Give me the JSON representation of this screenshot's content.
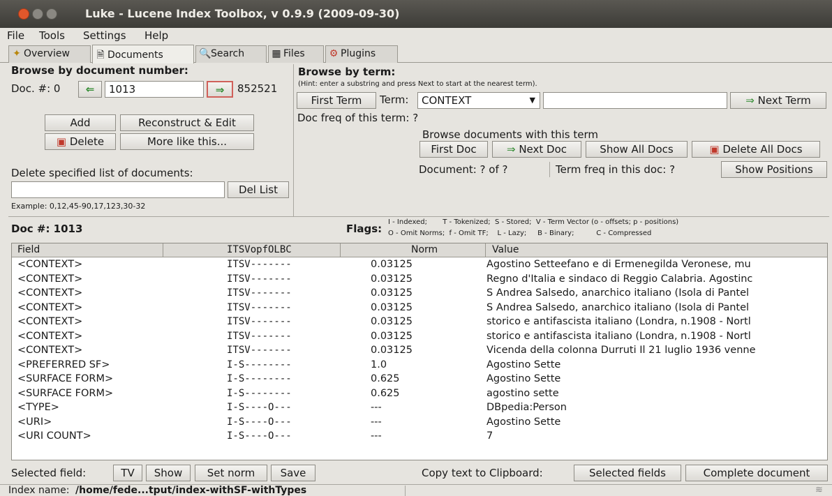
{
  "window": {
    "title": "Luke - Lucene Index Toolbox, v 0.9.9 (2009-09-30)"
  },
  "menu": [
    "File",
    "Tools",
    "Settings",
    "Help"
  ],
  "tabs": [
    {
      "label": "Overview",
      "icon": "wand-icon"
    },
    {
      "label": "Documents",
      "icon": "documents-icon",
      "active": true
    },
    {
      "label": "Search",
      "icon": "search-icon"
    },
    {
      "label": "Files",
      "icon": "files-icon"
    },
    {
      "label": "Plugins",
      "icon": "plugins-icon"
    }
  ],
  "browse_doc": {
    "heading": "Browse by document number:",
    "doc_label": "Doc. #: 0",
    "doc_value": "1013",
    "max_doc": "852521",
    "add": "Add",
    "reconstruct": "Reconstruct & Edit",
    "delete": "Delete",
    "more_like": "More like this...",
    "delete_list_label": "Delete specified list of documents:",
    "delete_list_value": "",
    "del_list": "Del List",
    "example": "Example: 0,12,45-90,17,123,30-32"
  },
  "browse_term": {
    "heading": "Browse by term:",
    "hint": "(Hint: enter a substring and press Next to start at the nearest term).",
    "first_term": "First Term",
    "term_label": "Term:",
    "term_field": "CONTEXT",
    "term_value": "",
    "next_term": "Next Term",
    "doc_freq": "Doc freq of this term: ?",
    "browse_docs_label": "Browse documents with this term",
    "first_doc": "First Doc",
    "next_doc": "Next Doc",
    "show_all": "Show All Docs",
    "delete_all": "Delete All Docs",
    "document_of": "Document: ?  of  ?",
    "term_freq": "Term freq in this doc: ?",
    "show_positions": "Show Positions"
  },
  "doc_header": {
    "doc_num": "Doc #: 1013",
    "flags_label": "Flags:",
    "flags_line1": "I - Indexed;       T - Tokenized;  S - Stored;  V - Term Vector (o - offsets; p - positions)",
    "flags_line2": "O - Omit Norms;  f - Omit TF;    L - Lazy;     B - Binary;          C - Compressed"
  },
  "table": {
    "columns": [
      "Field",
      "ITSVopfOLBC",
      "Norm",
      "Value"
    ],
    "rows": [
      [
        "<CONTEXT>",
        "ITSV-------",
        "0.03125",
        "Agostino Setteefano e di Ermenegilda Veronese, mu"
      ],
      [
        "<CONTEXT>",
        "ITSV-------",
        "0.03125",
        "Regno d'Italia e sindaco di Reggio Calabria. Agostinc"
      ],
      [
        "<CONTEXT>",
        "ITSV-------",
        "0.03125",
        "S Andrea Salsedo, anarchico italiano (Isola di Pantel"
      ],
      [
        "<CONTEXT>",
        "ITSV-------",
        "0.03125",
        "S Andrea Salsedo, anarchico italiano (Isola di Pantel"
      ],
      [
        "<CONTEXT>",
        "ITSV-------",
        "0.03125",
        "storico e antifascista italiano (Londra, n.1908 - Nortl"
      ],
      [
        "<CONTEXT>",
        "ITSV-------",
        "0.03125",
        "storico e antifascista italiano (Londra, n.1908 - Nortl"
      ],
      [
        "<CONTEXT>",
        "ITSV-------",
        "0.03125",
        "Vicenda della colonna Durruti Il 21 luglio 1936 venne"
      ],
      [
        "<PREFERRED SF>",
        "I-S--------",
        "1.0",
        "Agostino Sette"
      ],
      [
        "<SURFACE FORM>",
        "I-S--------",
        "0.625",
        "Agostino Sette"
      ],
      [
        "<SURFACE FORM>",
        "I-S--------",
        "0.625",
        "agostino sette"
      ],
      [
        "<TYPE>",
        "I-S----O---",
        "---",
        "DBpedia:Person"
      ],
      [
        "<URI>",
        "I-S----O---",
        "---",
        "Agostino Sette"
      ],
      [
        "<URI COUNT>",
        "I-S----O---",
        "---",
        "7"
      ]
    ]
  },
  "bottom": {
    "selected_field": "Selected field:",
    "tv": "TV",
    "show": "Show",
    "set_norm": "Set norm",
    "save": "Save",
    "copy_label": "Copy text to Clipboard:",
    "selected_fields": "Selected fields",
    "complete_document": "Complete document"
  },
  "status": {
    "index_label": "Index name:",
    "index_path": "/home/fede...tput/index-withSF-withTypes"
  },
  "colors": {
    "close_btn": "#e2572b",
    "min_btn": "#8a8882",
    "arrow_green": "#2f8a2f",
    "titlebar": "#3c3b37"
  }
}
